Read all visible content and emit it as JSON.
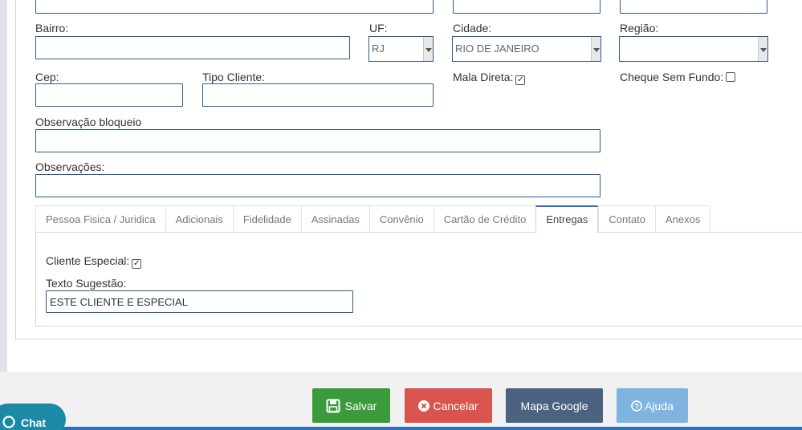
{
  "form": {
    "bairro_label": "Bairro:",
    "uf_label": "UF:",
    "uf_value": "RJ",
    "cidade_label": "Cidade:",
    "cidade_value": "RIO DE JANEIRO",
    "regiao_label": "Região:",
    "regiao_value": "",
    "cep_label": "Cep:",
    "tipo_cliente_label": "Tipo Cliente:",
    "mala_direta_label": "Mala Direta:",
    "mala_direta_checked": true,
    "cheque_label": "Cheque Sem Fundo:",
    "cheque_checked": false,
    "obs_bloqueio_label": "Observação bloqueio",
    "observacoes_label": "Observações:"
  },
  "tabs": [
    {
      "label": "Pessoa Fisica / Juridica"
    },
    {
      "label": "Adicionais"
    },
    {
      "label": "Fidelidade"
    },
    {
      "label": "Assinadas"
    },
    {
      "label": "Convênio"
    },
    {
      "label": "Cartão de Crédito"
    },
    {
      "label": "Entregas",
      "active": true
    },
    {
      "label": "Contato"
    },
    {
      "label": "Anexos"
    }
  ],
  "entregas": {
    "cliente_especial_label": "Cliente Especial:",
    "cliente_especial_checked": true,
    "texto_sugestao_label": "Texto Sugestão:",
    "texto_sugestao_value": "ESTE CLIENTE E ESPECIAL"
  },
  "buttons": {
    "salvar": "Salvar",
    "cancelar": "Cancelar",
    "mapa": "Mapa Google",
    "ajuda": "Ajuda"
  },
  "chat": {
    "label": "Chat"
  },
  "colors": {
    "salvar": "#3a9a3c",
    "cancelar": "#d9534f",
    "mapa": "#4b6280",
    "ajuda": "#7fb3e0",
    "tab_active": "#2c6fbb"
  }
}
